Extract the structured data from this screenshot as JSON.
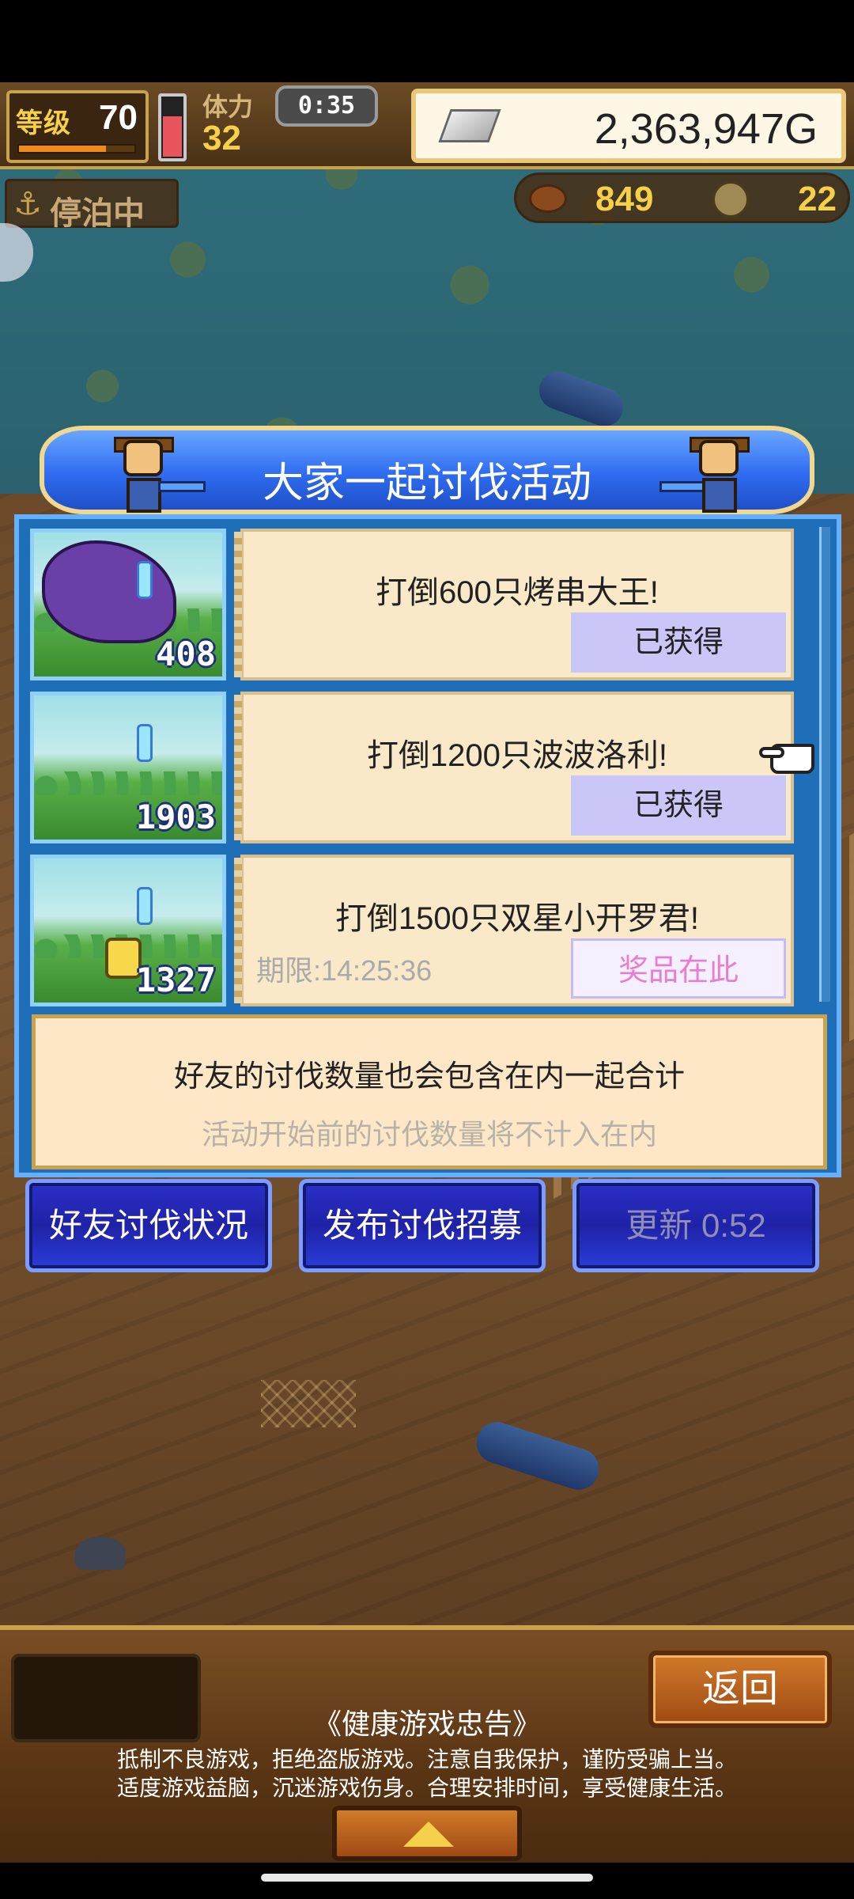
{
  "hud": {
    "level_label": "等级",
    "level": "70",
    "exp_fraction": 0.75,
    "stamina_label": "体力",
    "stamina": "32",
    "stamina_fraction": 0.7,
    "timer": "0:35",
    "gold": "2,363,947G",
    "docked_label": "停泊中",
    "food": "849",
    "medals": "22"
  },
  "event": {
    "title": "大家一起讨伐活动",
    "rows": [
      {
        "kill_count": "408",
        "title": "打倒600只烤串大王!",
        "badge": "已获得",
        "thumb_type": "boss"
      },
      {
        "kill_count": "1903",
        "title": "打倒1200只波波洛利!",
        "badge": "已获得",
        "thumb_type": "plain"
      },
      {
        "kill_count": "1327",
        "title": "打倒1500只双星小开罗君!",
        "deadline": "期限:14:25:36",
        "badge": "奖品在此",
        "thumb_type": "chick"
      }
    ],
    "info_main": "好友的讨伐数量也会包含在内一起合计",
    "info_sub": "活动开始前的讨伐数量将不计入在内"
  },
  "buttons": {
    "friend_status": "好友讨伐状况",
    "post_recruit": "发布讨伐招募",
    "refresh": "更新 0:52"
  },
  "bottom": {
    "back": "返回",
    "notice_title": "《健康游戏忠告》",
    "notice_line1": "抵制不良游戏，拒绝盗版游戏。注意自我保护，谨防受骗上当。",
    "notice_line2": "适度游戏益脑，沉迷游戏伤身。合理安排时间，享受健康生活。"
  },
  "icons": {
    "anchor": "anchor-icon",
    "gold": "silver-bar-icon",
    "food": "meat-icon",
    "medal": "medal-icon",
    "pointer": "pointing-hand-icon",
    "expand": "triangle-up-icon"
  },
  "colors": {
    "accent_blue": "#2f6cf0",
    "badge_obtained": "#cbc6f8",
    "prize_text": "#e77fd0"
  }
}
